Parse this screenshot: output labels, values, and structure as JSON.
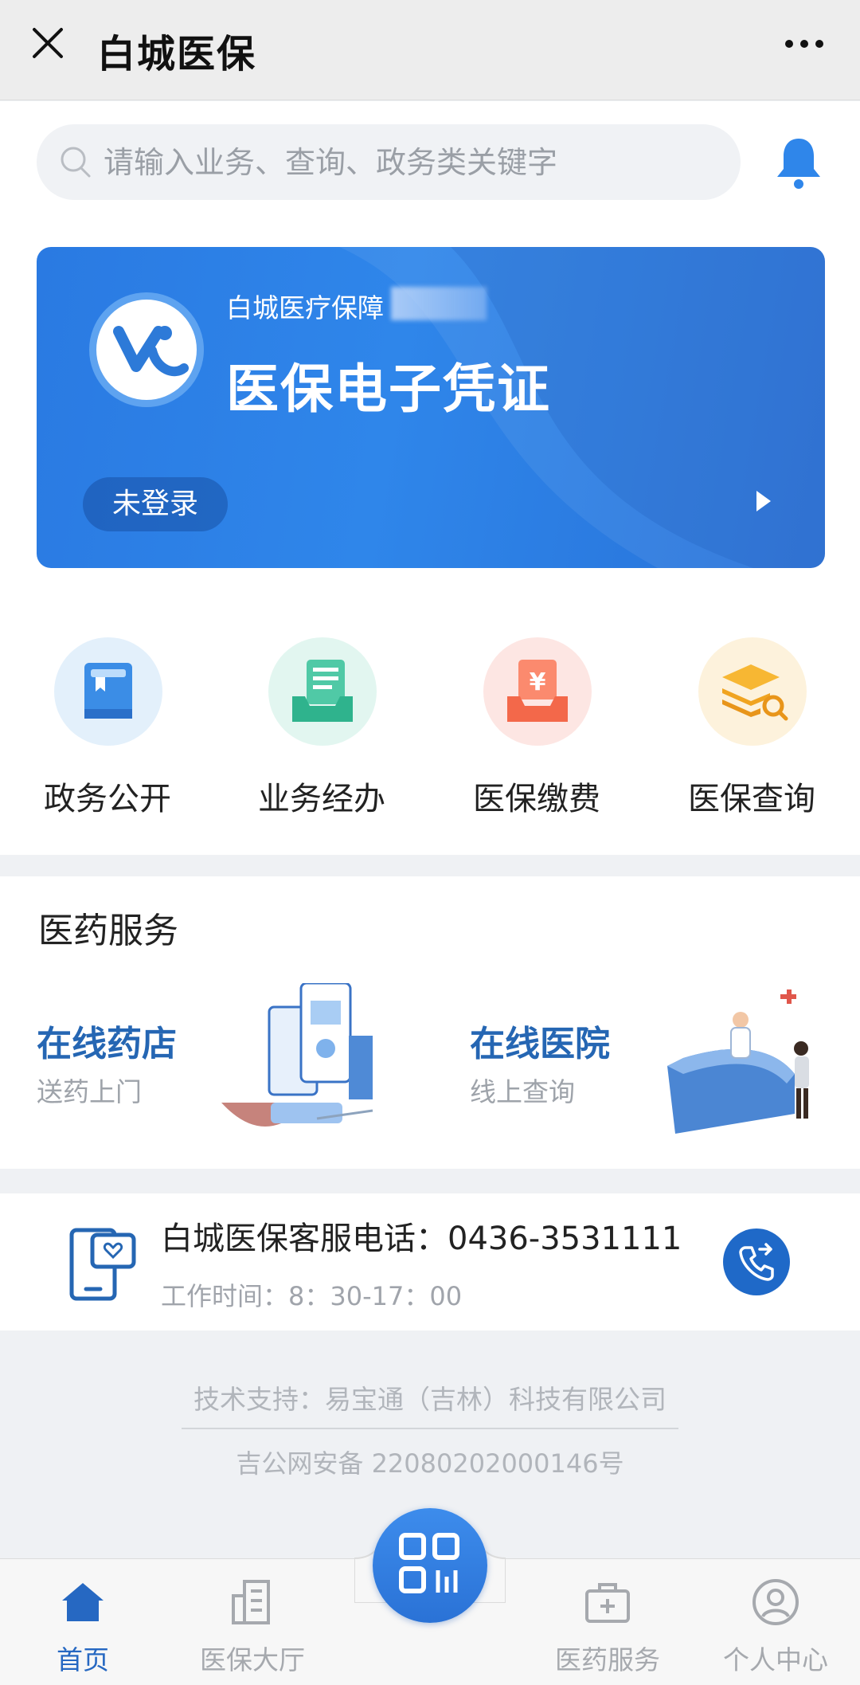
{
  "header": {
    "title": "白城医保"
  },
  "search": {
    "placeholder": "请输入业务、查询、政务类关键字"
  },
  "card": {
    "subtitle": "白城医疗保障",
    "title": "医保电子凭证",
    "login_status": "未登录"
  },
  "quick_actions": [
    {
      "label": "政务公开",
      "icon": "book-icon",
      "color": "#e3f0fb"
    },
    {
      "label": "业务经办",
      "icon": "document-tray-icon",
      "color": "#e2f6f0"
    },
    {
      "label": "医保缴费",
      "icon": "yuan-tray-icon",
      "color": "#fde6e3"
    },
    {
      "label": "医保查询",
      "icon": "layers-search-icon",
      "color": "#fdf2dc"
    }
  ],
  "medical_services": {
    "title": "医药服务",
    "items": [
      {
        "title": "在线药店",
        "subtitle": "送药上门"
      },
      {
        "title": "在线医院",
        "subtitle": "线上查询"
      }
    ]
  },
  "hotline": {
    "text": "白城医保客服电话：0436-3531111",
    "hours": "工作时间：8：30-17：00"
  },
  "footer": {
    "tech_support": "技术支持：易宝通（吉林）科技有限公司",
    "icp": "吉公网安备 22080202000146号"
  },
  "tabbar": {
    "items": [
      {
        "label": "首页"
      },
      {
        "label": "医保大厅"
      },
      {
        "label": "医药服务"
      },
      {
        "label": "个人中心"
      }
    ]
  },
  "colors": {
    "primary": "#2668c2",
    "accent": "#2f86ea"
  }
}
